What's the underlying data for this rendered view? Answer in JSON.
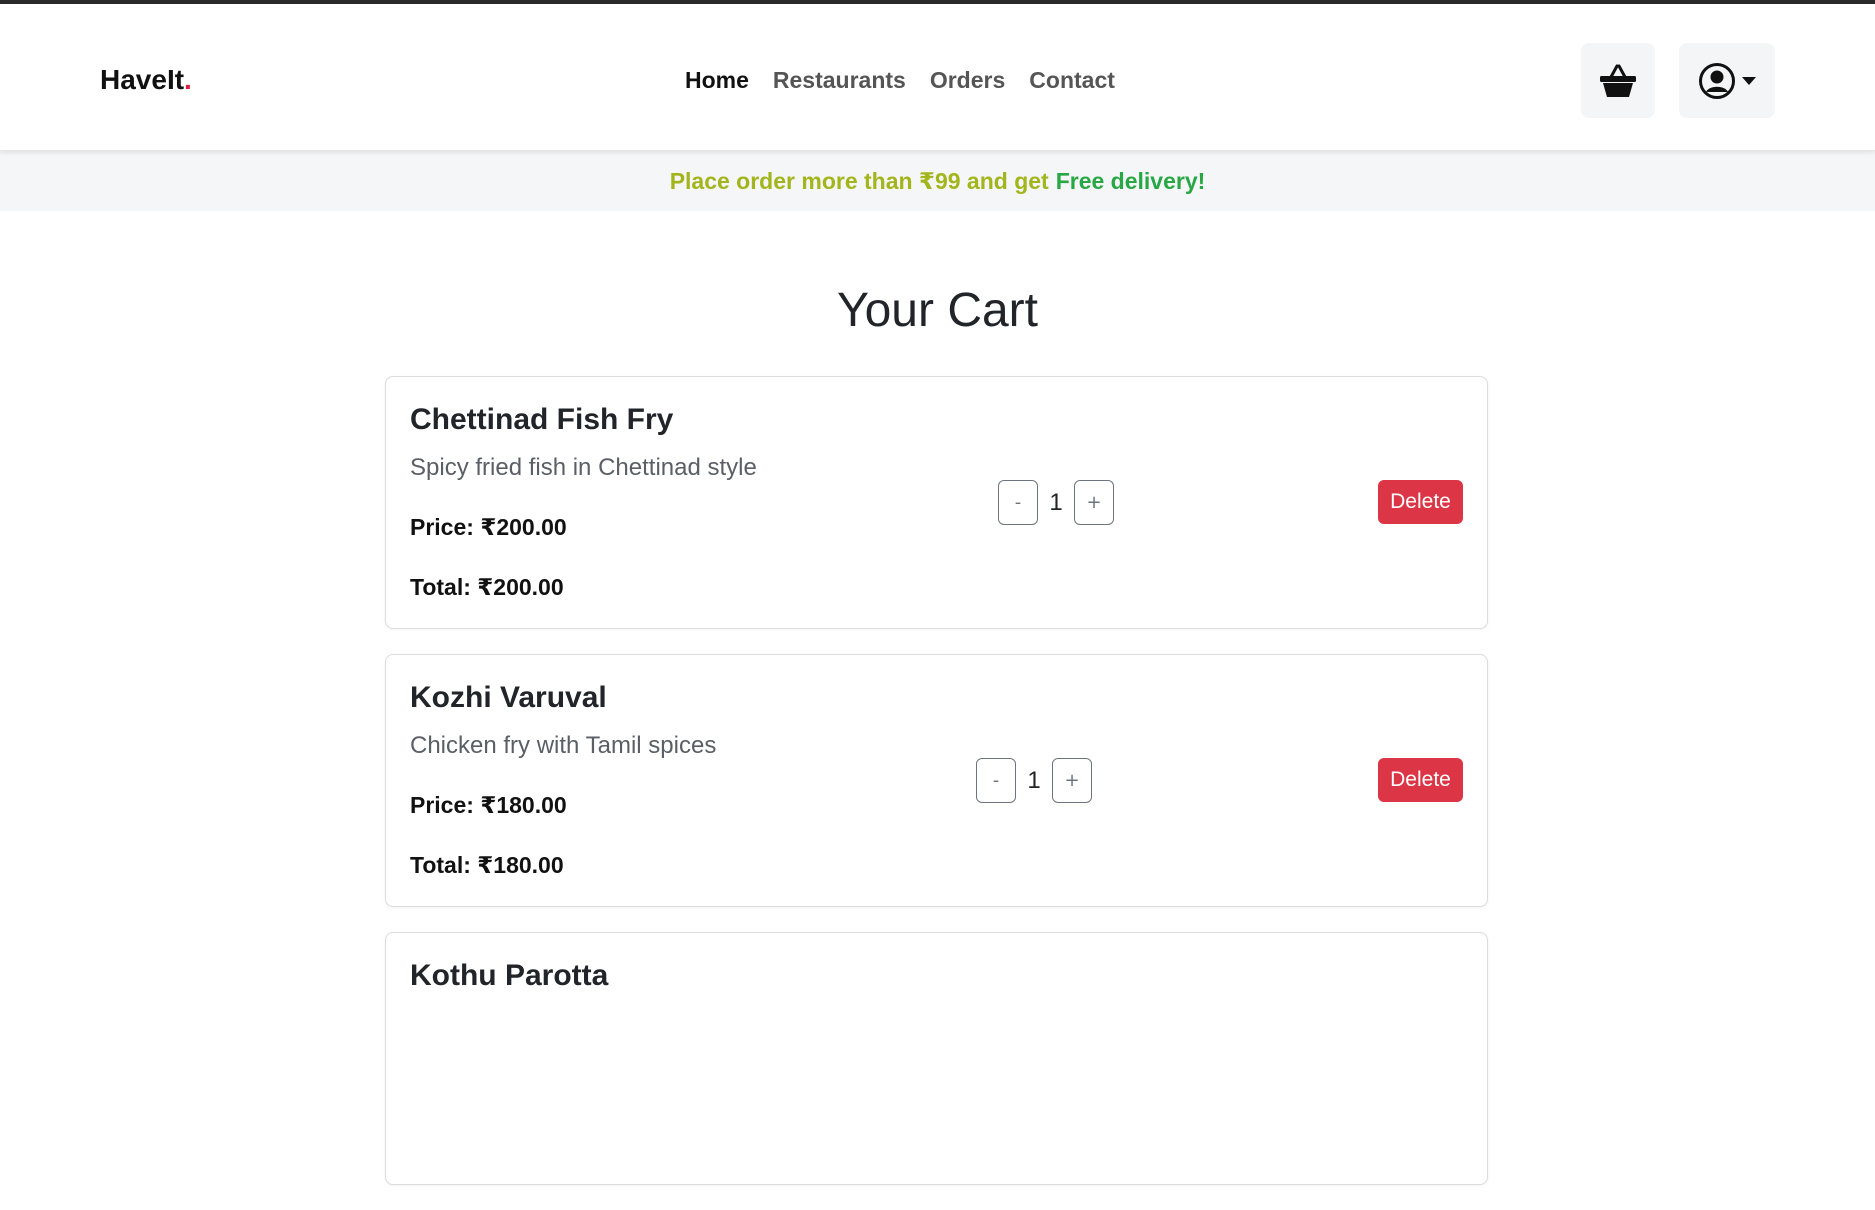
{
  "brand": {
    "name": "HaveIt",
    "dot": "."
  },
  "nav": {
    "items": [
      {
        "label": "Home"
      },
      {
        "label": "Restaurants"
      },
      {
        "label": "Orders"
      },
      {
        "label": "Contact"
      }
    ],
    "active": "Home"
  },
  "header_icons": {
    "cart": "basket-icon",
    "user": "user-circle-icon",
    "dropdown": "caret-down-icon"
  },
  "promo": {
    "text_main": "Place order more than ₹99 and get",
    "text_highlight": "Free delivery!"
  },
  "page": {
    "title": "Your Cart"
  },
  "cart": {
    "items": [
      {
        "name": "Chettinad Fish Fry",
        "description": "Spicy fried fish in Chettinad style",
        "price": "Price: ₹200.00",
        "total": "Total: ₹200.00",
        "quantity": "1",
        "minus_label": "-",
        "plus_label": "+",
        "delete_label": "Delete"
      },
      {
        "name": "Kozhi Varuval",
        "description": "Chicken fry with Tamil spices",
        "price": "Price: ₹180.00",
        "total": "Total: ₹180.00",
        "quantity": "1",
        "minus_label": "-",
        "plus_label": "+",
        "delete_label": "Delete"
      },
      {
        "name": "Kothu Parotta"
      }
    ]
  },
  "colors": {
    "brand_dot": "#dc1f3f",
    "promo_main": "#a3b51c",
    "promo_highlight": "#28a745",
    "delete": "#dc3545"
  }
}
